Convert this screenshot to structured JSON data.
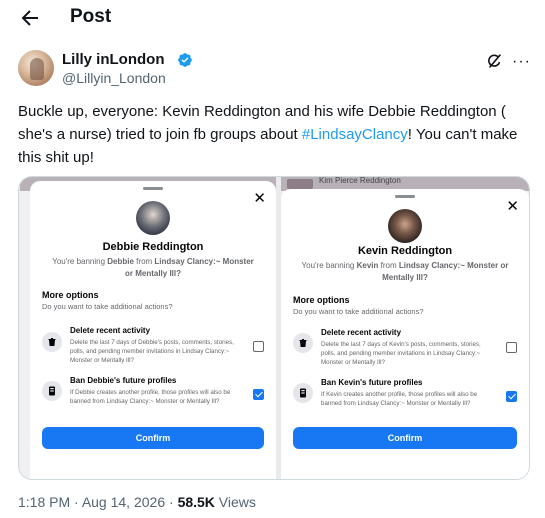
{
  "header": {
    "title": "Post"
  },
  "author": {
    "display_name": "Lilly inLondon",
    "handle": "@Lillyin_London"
  },
  "tweet": {
    "text_before": "Buckle up, everyone: Kevin Reddington and his wife Debbie Reddington ( she's a nurse) tried to join fb groups about ",
    "hashtag": "#LindsayClancy",
    "text_after": "! You can't make this shit up!"
  },
  "media": {
    "left": {
      "name": "Debbie Reddington",
      "banning_prefix": "You're banning ",
      "banning_name": "Debbie",
      "banning_mid": " from ",
      "banning_group": "Lindsay Clancy:~ Monster or Mentally Ill?",
      "more_options": "More options",
      "more_options_sub": "Do you want to take additional actions?",
      "opt1_label": "Delete recent activity",
      "opt1_desc": "Delete the last 7 days of Debbie's posts, comments, stories, polls, and pending member invitations in Lindsay Clancy:~ Monster or Mentally Ill?",
      "opt1_checked": false,
      "opt2_label": "Ban Debbie's future profiles",
      "opt2_desc": "If Debbie creates another profile, those profiles will also be banned from Lindsay Clancy:~ Monster or Mentally Ill?",
      "opt2_checked": true,
      "confirm": "Confirm"
    },
    "right": {
      "peek_name": "Kim Pierce Reddington",
      "name": "Kevin Reddington",
      "banning_prefix": "You're banning ",
      "banning_name": "Kevin",
      "banning_mid": " from ",
      "banning_group": "Lindsay Clancy:~ Monster or Mentally Ill?",
      "more_options": "More options",
      "more_options_sub": "Do you want to take additional actions?",
      "opt1_label": "Delete recent activity",
      "opt1_desc": "Delete the last 7 days of Kevin's posts, comments, stories, polls, and pending member invitations in Lindsay Clancy:~ Monster or Mentally Ill?",
      "opt1_checked": false,
      "opt2_label": "Ban Kevin's future profiles",
      "opt2_desc": "If Kevin creates another profile, those profiles will also be banned from Lindsay Clancy:~ Monster or Mentally Ill?",
      "opt2_checked": true,
      "confirm": "Confirm"
    }
  },
  "meta": {
    "time": "1:18 PM",
    "separator": " · ",
    "date": "Aug 14, 2026",
    "views_count": "58.5K",
    "views_label": " Views"
  },
  "colors": {
    "accent": "#1d9bf0",
    "fb_blue": "#1877f2",
    "muted": "#536471"
  },
  "icons": {
    "back": "arrow-left-icon",
    "verified": "verified-badge-icon",
    "grok": "grok-icon",
    "more": "more-dots-icon"
  }
}
